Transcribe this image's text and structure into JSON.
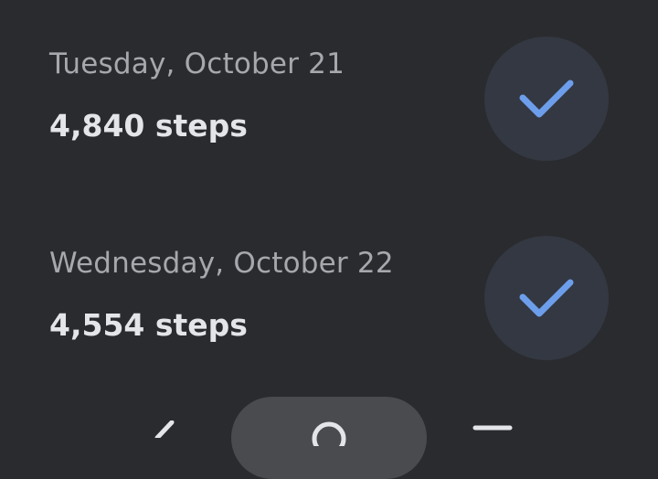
{
  "entries": [
    {
      "date": "Tuesday, October 21",
      "steps": "4,840 steps",
      "completed": true
    },
    {
      "date": "Wednesday, October 22",
      "steps": "4,554 steps",
      "completed": true
    }
  ],
  "colors": {
    "background": "#2a2b2f",
    "check_circle": "#333842",
    "check_mark": "#6d9eeb",
    "date_text": "#a6a8ad",
    "steps_text": "#e4e5e8",
    "nav_pill": "#4a4b4f"
  },
  "icons": {
    "check": "check-icon",
    "nav_back": "back-chevron-icon",
    "nav_home": "search-icon",
    "nav_recents": "recents-icon"
  }
}
